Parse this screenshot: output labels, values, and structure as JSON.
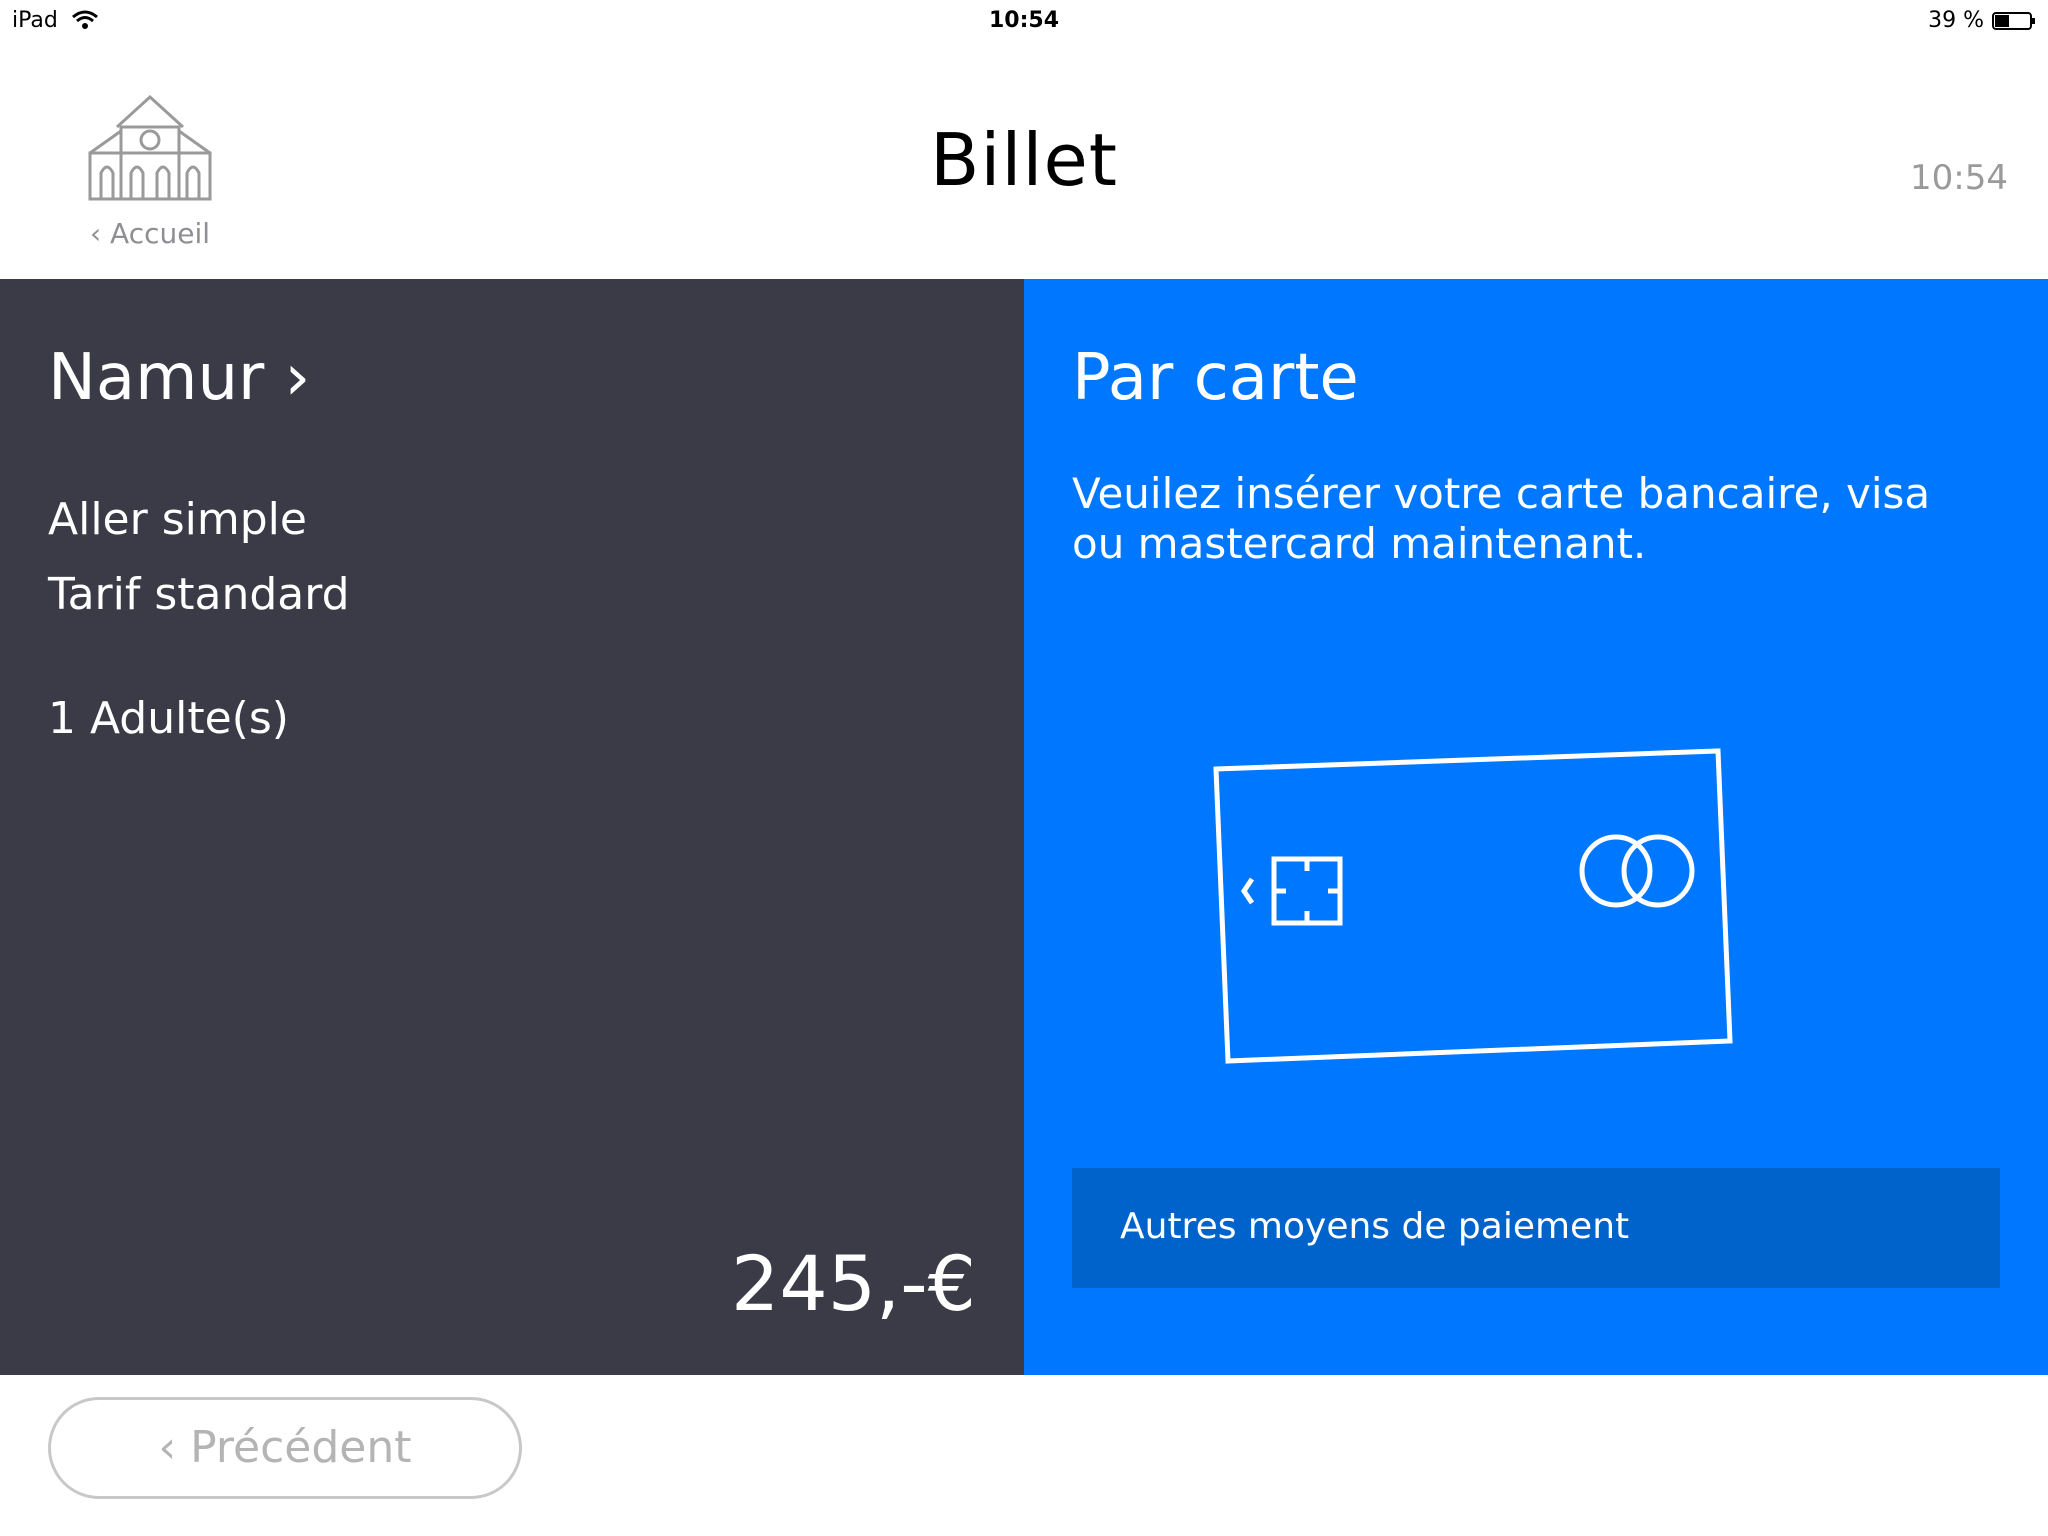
{
  "status_bar": {
    "device": "iPad",
    "time": "10:54",
    "battery": "39 %",
    "battery_level": 0.39
  },
  "header": {
    "home_label": "‹ Accueil",
    "title": "Billet",
    "time": "10:54"
  },
  "ticket": {
    "destination": "Namur ›",
    "trip_type": "Aller simple",
    "fare": "Tarif standard",
    "passengers": "1 Adulte(s)",
    "price": "245,-€"
  },
  "payment": {
    "title": "Par carte",
    "instruction": "Veuilez insérer votre carte bancaire, visa ou mastercard maintenant.",
    "other_methods_label": "Autres moyens de paiement"
  },
  "footer": {
    "previous_label": "‹ Précédent"
  },
  "colors": {
    "left_panel": "#3b3b47",
    "right_panel": "#0077ff",
    "button": "#0063cc"
  }
}
